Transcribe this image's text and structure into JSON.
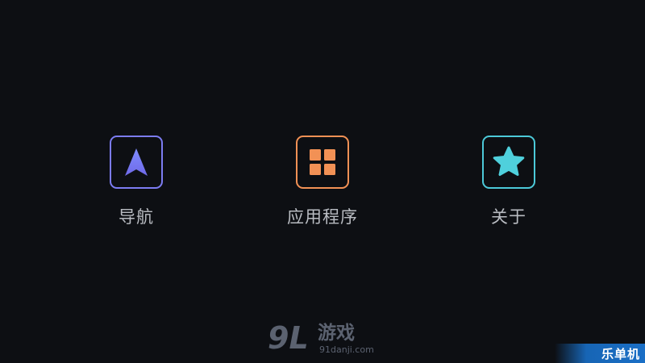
{
  "menu": {
    "items": [
      {
        "id": "navigation",
        "label": "导航",
        "icon": "navigation-arrow-icon",
        "color": "#7c7cf2"
      },
      {
        "id": "applications",
        "label": "应用程序",
        "icon": "apps-grid-icon",
        "color": "#f29155"
      },
      {
        "id": "about",
        "label": "关于",
        "icon": "star-icon",
        "color": "#4cc9d8"
      }
    ]
  },
  "watermark": {
    "digits": "9L",
    "text": "游戏",
    "url": "91danji.com"
  },
  "corner_badge": {
    "text": "乐单机"
  },
  "colors": {
    "background": "#0d0f13",
    "label_text": "#b9bcc2",
    "badge_blue": "#1a6fc6"
  }
}
